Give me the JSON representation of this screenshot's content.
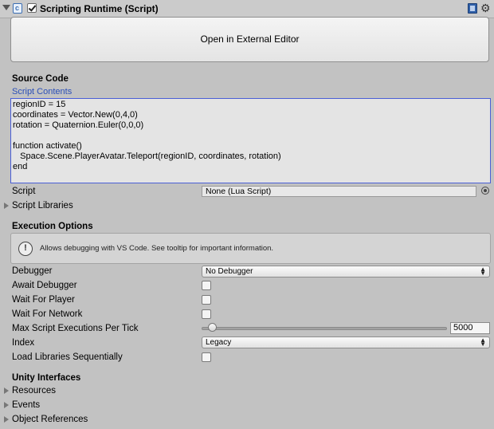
{
  "header": {
    "title": "Scripting Runtime (Script)",
    "enabled": true,
    "icons": [
      "fold-triangle-icon",
      "script-icon",
      "help-book-icon",
      "gear-icon"
    ]
  },
  "open_button": "Open in External Editor",
  "source_code": {
    "heading": "Source Code",
    "contents_label": "Script Contents",
    "code": "regionID = 15\ncoordinates = Vector.New(0,4,0)\nrotation = Quaternion.Euler(0,0,0)\n\nfunction activate()\n   Space.Scene.PlayerAvatar.Teleport(regionID, coordinates, rotation)\nend"
  },
  "script": {
    "label": "Script",
    "value": "None (Lua Script)"
  },
  "script_libraries": "Script Libraries",
  "execution": {
    "heading": "Execution Options",
    "help_text": "Allows debugging with VS Code. See tooltip for important information.",
    "debugger_label": "Debugger",
    "debugger_value": "No Debugger",
    "await_debugger": "Await Debugger",
    "wait_for_player": "Wait For Player",
    "wait_for_network": "Wait For Network",
    "max_exec_label": "Max Script Executions Per Tick",
    "max_exec_value": "5000",
    "index_label": "Index",
    "index_value": "Legacy",
    "load_seq": "Load Libraries Sequentially"
  },
  "unity": {
    "heading": "Unity Interfaces",
    "items": [
      "Resources",
      "Events",
      "Object References"
    ]
  },
  "colors": {
    "background": "#c2c2c2",
    "link": "#2a4fb8",
    "focus_border": "#4a5fd6"
  }
}
